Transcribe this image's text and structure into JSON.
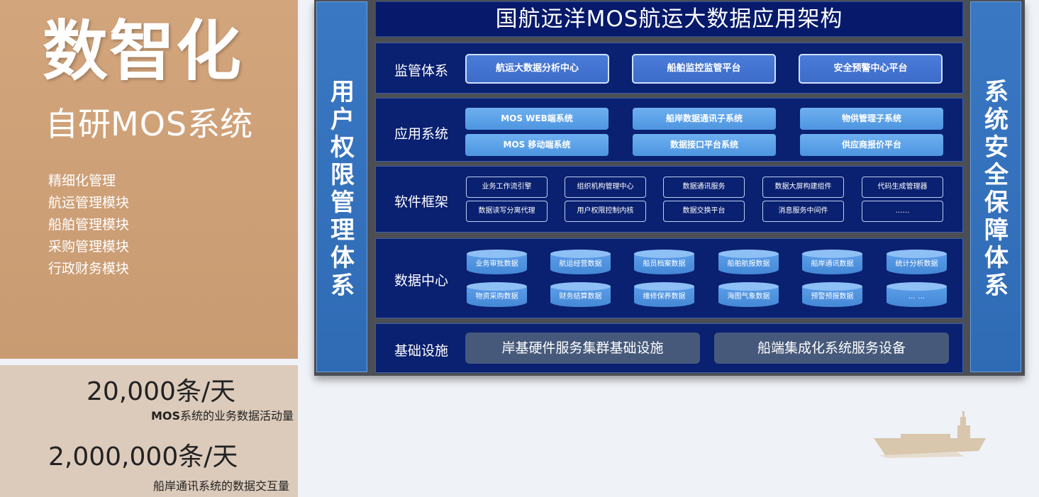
{
  "left_panel": {
    "brand_title": "数智化",
    "brand_subtitle_prefix": "自研",
    "brand_subtitle_mid": "MOS",
    "brand_subtitle_suffix": "系统",
    "features": [
      "精细化管理",
      "航运管理模块",
      "船舶管理模块",
      "采购管理模块",
      "行政财务模块"
    ]
  },
  "stats": {
    "stat1_value": "20,000条/天",
    "stat1_desc_bold": "MOS",
    "stat1_desc_text": "系统的业务数据活动量",
    "stat2_value": "2,000,000条/天",
    "stat2_desc": "船岸通讯系统的数据交互量"
  },
  "architecture": {
    "title": "国航远洋MOS航运大数据应用架构",
    "left_column": "用户权限管理体系",
    "right_column": "系统安全保障体系",
    "supervision": {
      "label": "监管体系",
      "items": [
        "航运大数据分析中心",
        "船舶监控监管平台",
        "安全预警中心平台"
      ]
    },
    "application": {
      "label": "应用系统",
      "items": [
        "MOS WEB端系统",
        "船岸数据通讯子系统",
        "物供管理子系统",
        "MOS 移动端系统",
        "数据接口平台系统",
        "供应商报价平台"
      ]
    },
    "framework": {
      "label": "软件框架",
      "items": [
        "业务工作流引擎",
        "组织机构管理中心",
        "数据通讯服务",
        "数据大屏构建组件",
        "代码生成管理器",
        "数据读写分离代理",
        "用户权限控制内核",
        "数据交换平台",
        "消息服务中间件",
        "……"
      ]
    },
    "data_center": {
      "label": "数据中心",
      "items": [
        "业务审批数据",
        "航运经营数据",
        "船员档案数据",
        "船舶航报数据",
        "船岸通讯数据",
        "统计分析数据",
        "物资采购数据",
        "财务结算数据",
        "维修保养数据",
        "海图气象数据",
        "预警预报数据",
        "… …"
      ]
    },
    "infrastructure": {
      "label": "基础设施",
      "items": [
        "岸基硬件服务集群基础设施",
        "船端集成化系统服务设备"
      ]
    }
  },
  "colors": {
    "left_panel_bg": "#cda077",
    "stats_bg": "#dccbbb",
    "layer_bg": "#0a2070",
    "side_column": "#3573bd",
    "infra_button": "#46597a"
  }
}
